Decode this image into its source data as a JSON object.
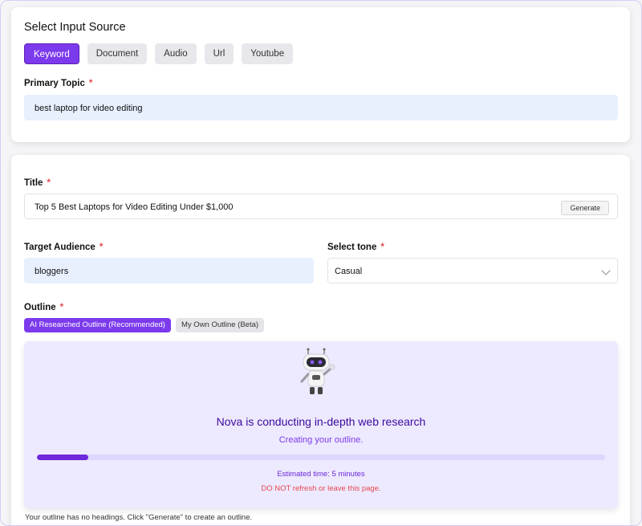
{
  "input_source": {
    "heading": "Select Input Source",
    "tabs": [
      {
        "label": "Keyword",
        "active": true
      },
      {
        "label": "Document",
        "active": false
      },
      {
        "label": "Audio",
        "active": false
      },
      {
        "label": "Url",
        "active": false
      },
      {
        "label": "Youtube",
        "active": false
      }
    ],
    "primary_topic_label": "Primary Topic",
    "primary_topic_value": "best laptop for video editing"
  },
  "required_marker": "*",
  "title_field": {
    "label": "Title",
    "value": "Top 5 Best Laptops for Video Editing Under $1,000",
    "generate_label": "Generate"
  },
  "audience_field": {
    "label": "Target Audience",
    "value": "bloggers"
  },
  "tone_field": {
    "label": "Select tone",
    "value": "Casual"
  },
  "outline": {
    "label": "Outline",
    "tabs": [
      {
        "label": "AI Researched Outline (Recommended)",
        "active": true
      },
      {
        "label": "My Own Outline (Beta)",
        "active": false
      }
    ],
    "research_title": "Nova is conducting in-depth web research",
    "research_subtitle": "Creating your outline.",
    "progress_fraction": 0.09,
    "estimated_time": "Estimated time: 5 minutes",
    "warning": "DO NOT refresh or leave this page.",
    "footnote": "Your outline has no headings. Click \"Generate\" to create an outline."
  },
  "colors": {
    "accent": "#7c3aed",
    "accent_dark": "#3b0a9c",
    "research_bg": "#ede9fe",
    "input_fill": "#e8f0fe",
    "required": "#e5484d"
  },
  "icons": {
    "robot": "robot-mascot-icon",
    "tone_dropdown": "chevron-down-icon"
  }
}
